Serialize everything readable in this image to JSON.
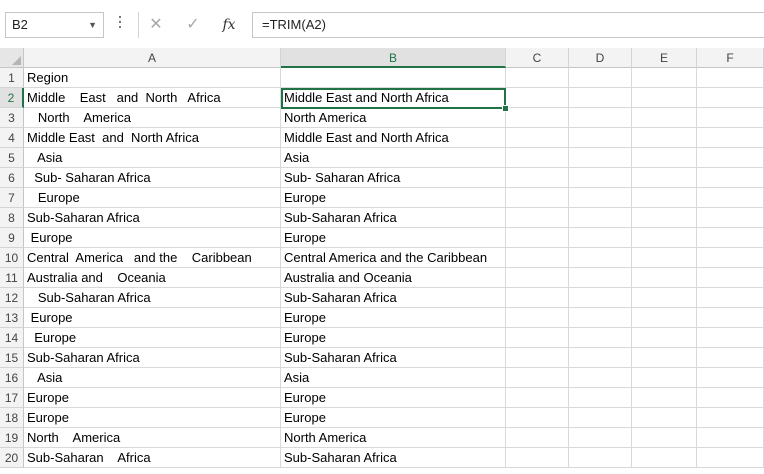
{
  "name_box": "B2",
  "formula_bar": {
    "cancel_icon": "✕",
    "enter_icon": "✓",
    "fx_label": "fx",
    "formula": "=TRIM(A2)"
  },
  "columns": [
    "A",
    "B",
    "C",
    "D",
    "E",
    "F"
  ],
  "selected_column": "B",
  "selected_row": "2",
  "rows": [
    {
      "num": "1",
      "a": "Region",
      "b": ""
    },
    {
      "num": "2",
      "a": "Middle    East   and  North   Africa",
      "b": "Middle East and North Africa"
    },
    {
      "num": "3",
      "a": "   North    America",
      "b": "North America"
    },
    {
      "num": "4",
      "a": "Middle East  and  North Africa",
      "b": "Middle East and North Africa"
    },
    {
      "num": "5",
      "a": "   Asia",
      "b": "Asia"
    },
    {
      "num": "6",
      "a": "  Sub- Saharan Africa",
      "b": "Sub- Saharan Africa"
    },
    {
      "num": "7",
      "a": "   Europe",
      "b": "Europe"
    },
    {
      "num": "8",
      "a": "Sub-Saharan Africa",
      "b": "Sub-Saharan Africa"
    },
    {
      "num": "9",
      "a": " Europe",
      "b": "Europe"
    },
    {
      "num": "10",
      "a": "Central  America   and the    Caribbean",
      "b": "Central America and the Caribbean"
    },
    {
      "num": "11",
      "a": "Australia and    Oceania",
      "b": "Australia and Oceania"
    },
    {
      "num": "12",
      "a": "   Sub-Saharan Africa",
      "b": "Sub-Saharan Africa"
    },
    {
      "num": "13",
      "a": " Europe",
      "b": "Europe"
    },
    {
      "num": "14",
      "a": "  Europe",
      "b": "Europe"
    },
    {
      "num": "15",
      "a": "Sub-Saharan Africa",
      "b": "Sub-Saharan Africa"
    },
    {
      "num": "16",
      "a": "   Asia",
      "b": "Asia"
    },
    {
      "num": "17",
      "a": "Europe",
      "b": "Europe"
    },
    {
      "num": "18",
      "a": "Europe",
      "b": "Europe"
    },
    {
      "num": "19",
      "a": "North    America",
      "b": "North America"
    },
    {
      "num": "20",
      "a": "Sub-Saharan    Africa",
      "b": "Sub-Saharan Africa"
    }
  ],
  "accent_color": "#217346"
}
